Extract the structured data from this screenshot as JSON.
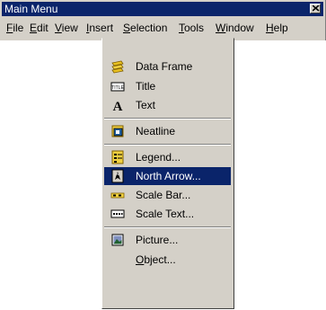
{
  "window": {
    "title": "Main Menu"
  },
  "menubar": {
    "items": [
      {
        "pre": "",
        "u": "F",
        "post": "ile"
      },
      {
        "pre": "",
        "u": "E",
        "post": "dit"
      },
      {
        "pre": "",
        "u": "V",
        "post": "iew"
      },
      {
        "pre": "",
        "u": "I",
        "post": "nsert"
      },
      {
        "pre": "",
        "u": "S",
        "post": "election"
      },
      {
        "pre": "",
        "u": "T",
        "post": "ools"
      },
      {
        "pre": "",
        "u": "W",
        "post": "indow"
      },
      {
        "pre": "",
        "u": "H",
        "post": "elp"
      }
    ]
  },
  "insert_menu": {
    "items": [
      {
        "label": "Data Frame",
        "icon": "data-frame-icon"
      },
      {
        "label": "Title",
        "icon": "title-icon"
      },
      {
        "label": "Text",
        "icon": "text-icon"
      },
      {
        "label": "Neatline",
        "icon": "neatline-icon"
      },
      {
        "label": "Legend...",
        "icon": "legend-icon"
      },
      {
        "label": "North Arrow...",
        "icon": "north-arrow-icon",
        "selected": true
      },
      {
        "label": "Scale Bar...",
        "icon": "scale-bar-icon"
      },
      {
        "label": "Scale Text...",
        "icon": "scale-text-icon"
      },
      {
        "label": "Picture...",
        "icon": "picture-icon"
      },
      {
        "pre": "",
        "u": "O",
        "post": "bject...",
        "icon": "none"
      }
    ]
  },
  "colors": {
    "titlebar": "#0a246a",
    "selection": "#0a246a",
    "face": "#d4d0c8"
  }
}
